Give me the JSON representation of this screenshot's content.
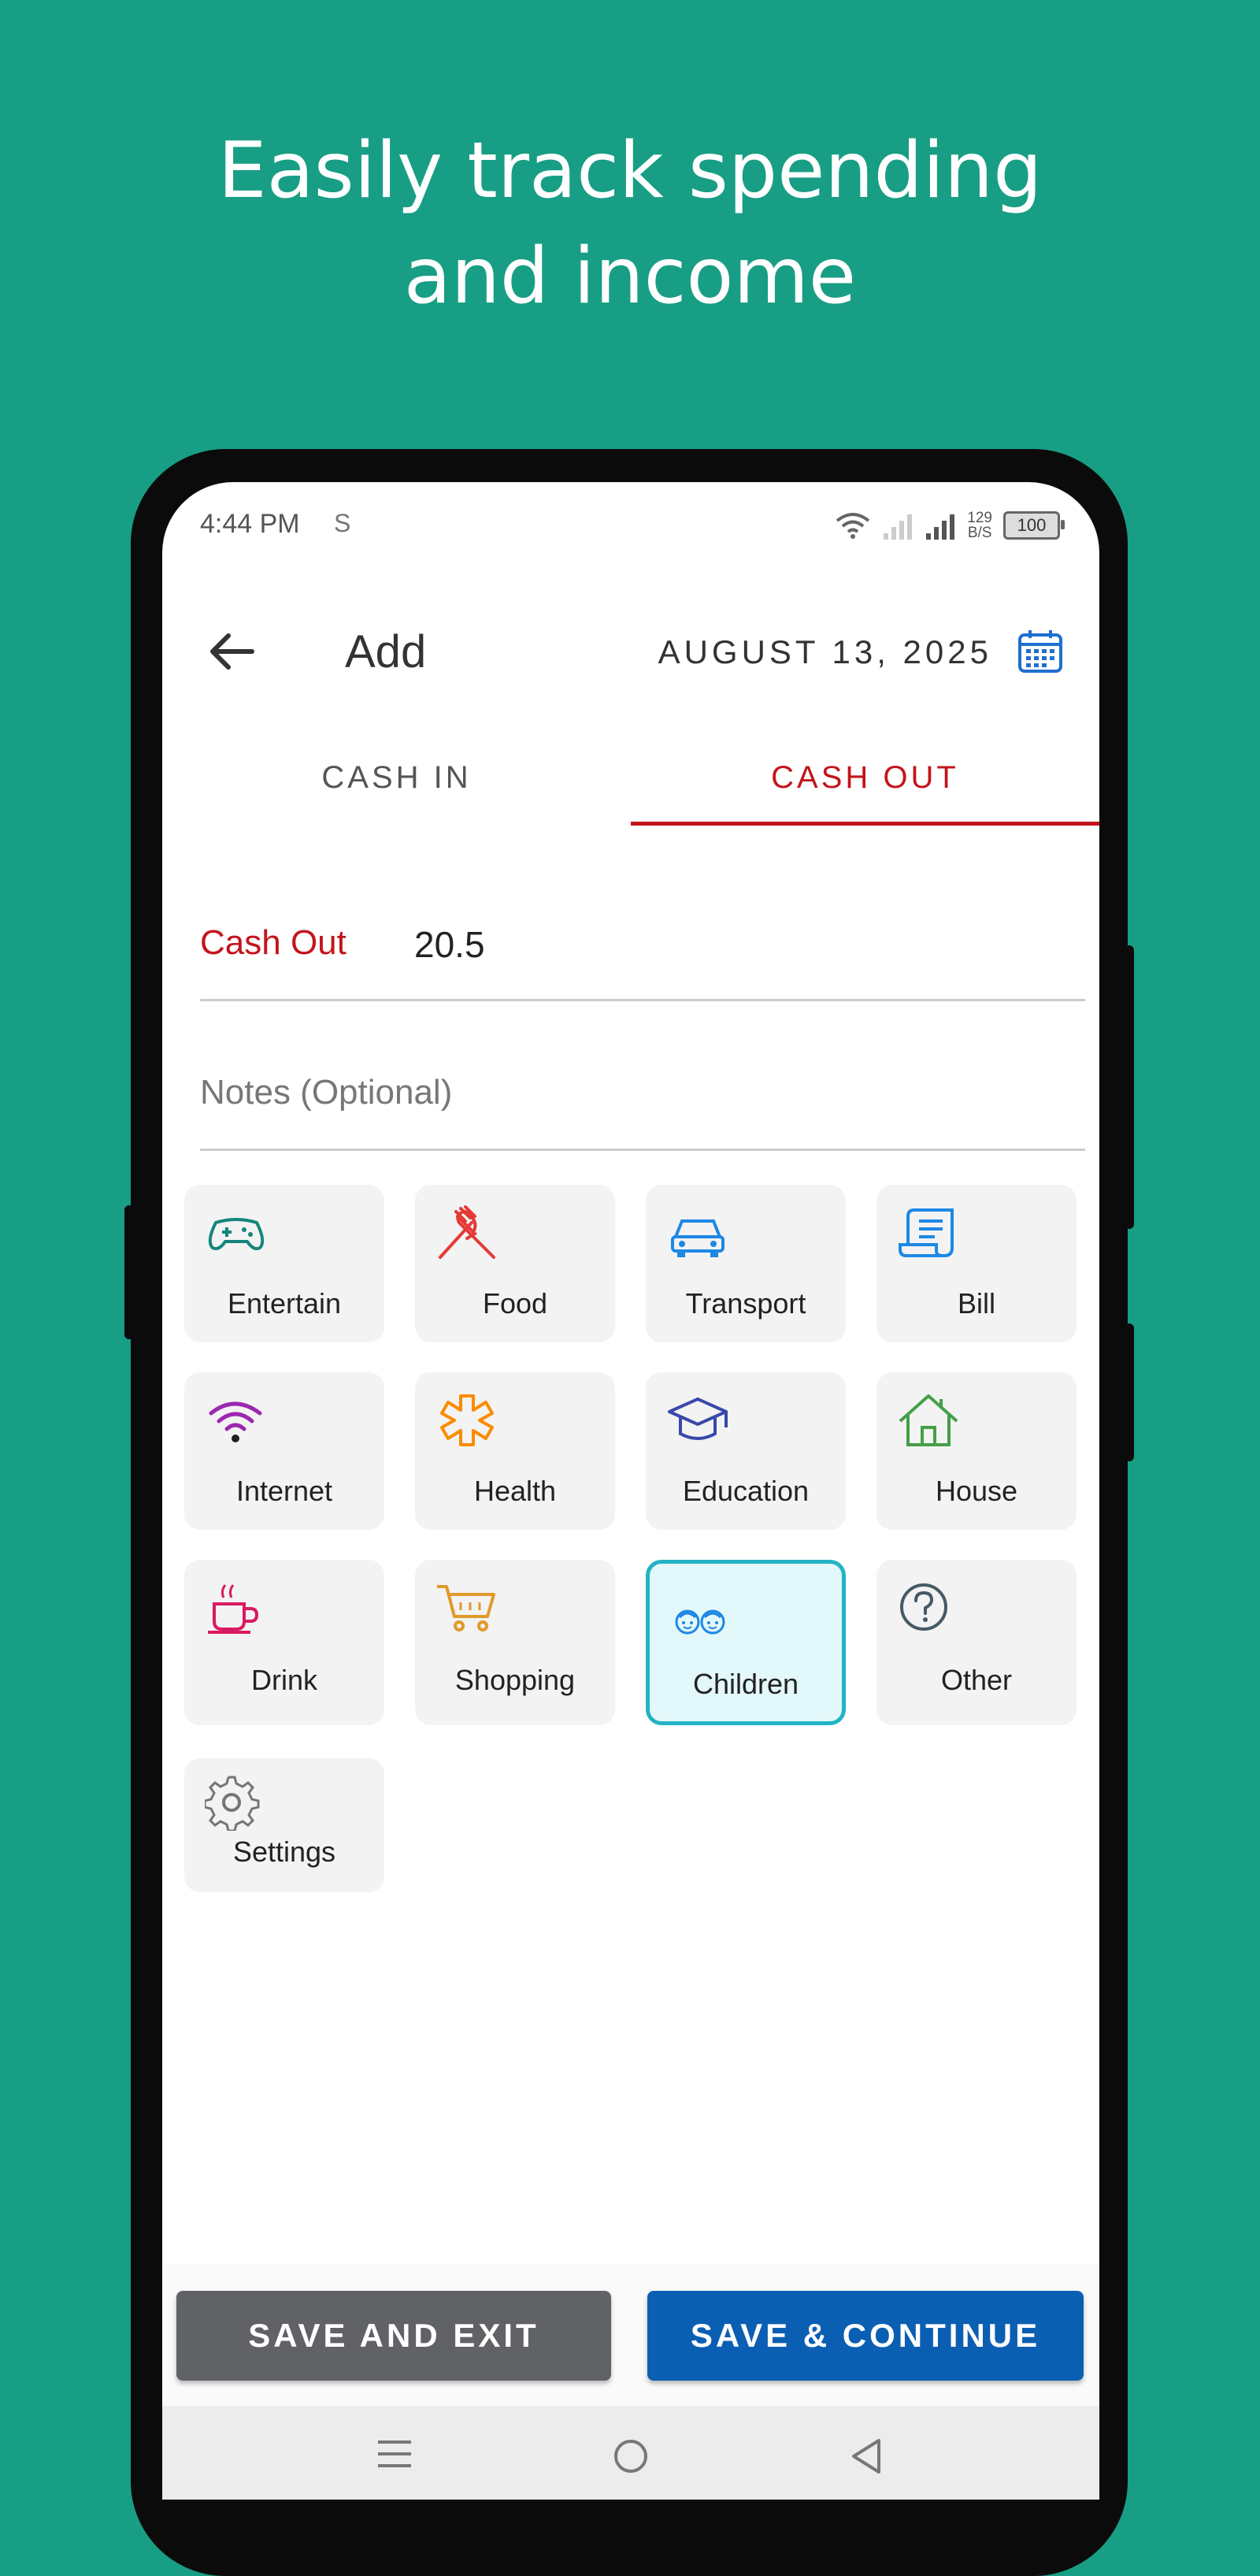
{
  "promo": {
    "headline_line1": "Easily track spending",
    "headline_line2": "and income"
  },
  "status_bar": {
    "time": "4:44 PM",
    "sync_icon": "S",
    "net_speed_value": "129",
    "net_speed_unit": "B/S",
    "battery": "100"
  },
  "header": {
    "title": "Add",
    "date": "AUGUST 13, 2025"
  },
  "tabs": {
    "cash_in": "CASH IN",
    "cash_out": "CASH OUT",
    "active": "cash_out"
  },
  "form": {
    "cash_out_label": "Cash Out",
    "cash_out_value": "20.5",
    "notes_placeholder": "Notes (Optional)"
  },
  "categories": [
    {
      "label": "Entertain",
      "icon": "gamepad-icon",
      "color": "#14857a"
    },
    {
      "label": "Food",
      "icon": "fork-knife-icon",
      "color": "#e53935"
    },
    {
      "label": "Transport",
      "icon": "car-icon",
      "color": "#1e88e5"
    },
    {
      "label": "Bill",
      "icon": "receipt-icon",
      "color": "#1e88e5"
    },
    {
      "label": "Internet",
      "icon": "wifi-icon",
      "color": "#9c27b0"
    },
    {
      "label": "Health",
      "icon": "health-icon",
      "color": "#fb8c00"
    },
    {
      "label": "Education",
      "icon": "graduation-cap-icon",
      "color": "#3949ab"
    },
    {
      "label": "House",
      "icon": "house-icon",
      "color": "#43a047"
    },
    {
      "label": "Drink",
      "icon": "coffee-cup-icon",
      "color": "#d81b60"
    },
    {
      "label": "Shopping",
      "icon": "cart-icon",
      "color": "#e09a2a"
    },
    {
      "label": "Children",
      "icon": "children-icon",
      "color": "#1e88e5",
      "selected": true
    },
    {
      "label": "Other",
      "icon": "question-icon",
      "color": "#455a64"
    },
    {
      "label": "Settings",
      "icon": "gear-icon",
      "color": "#757575"
    }
  ],
  "buttons": {
    "save_exit": "SAVE AND EXIT",
    "save_continue": "SAVE & CONTINUE"
  },
  "colors": {
    "background": "#189e84",
    "accent_red": "#c4141b",
    "primary_blue": "#0b5fb3",
    "selected_border": "#22b3c4"
  }
}
